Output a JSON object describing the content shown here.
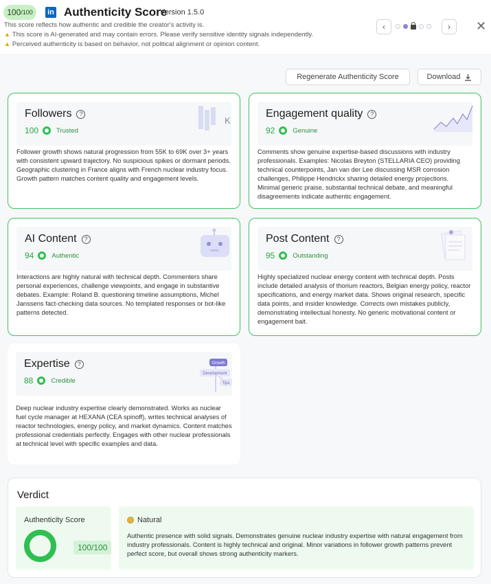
{
  "header": {
    "score_big": "100",
    "score_small": "/100",
    "title": "Authenticity Score",
    "version": "Version 1.5.0",
    "note1": "This score reflects how authentic and credible the creator's activity is.",
    "note2": "This score is AI-generated and may contain errors. Please verify sensitive identity signals independently.",
    "note3": "Perceived authenticity is based on behavior, not political alignment or opinion content."
  },
  "actions": {
    "regenerate": "Regenerate Authenticity Score",
    "download": "Download"
  },
  "cards": {
    "followers": {
      "title": "Followers",
      "score": "100",
      "label": "Trusted",
      "text": "Follower growth shows natural progression from 55K to 69K over 3+ years with consistent upward trajectory. No suspicious spikes or dormant periods. Geographic clustering in France aligns with French nuclear industry focus. Growth pattern matches content quality and engagement levels.",
      "icon_letter": "K"
    },
    "engagement": {
      "title": "Engagement quality",
      "score": "92",
      "label": "Genuine",
      "text": "Comments show genuine expertise-based discussions with industry professionals. Examples: Nicolas Breyton (STELLARIA CEO) providing technical counterpoints, Jan van der Lee discussing MSR corrosion challenges, Philippe Hendrickx sharing detailed energy projections. Minimal generic praise, substantial technical debate, and meaningful disagreements indicate authentic engagement."
    },
    "ai": {
      "title": "AI Content",
      "score": "94",
      "label": "Authentic",
      "text": "Interactions are highly natural with technical depth. Commenters share personal experiences, challenge viewpoints, and engage in substantive debates. Example: Roland B. questioning timeline assumptions, Michel Janssens fact-checking data sources. No templated responses or bot-like patterns detected."
    },
    "post": {
      "title": "Post Content",
      "score": "95",
      "label": "Outstanding",
      "text": "Highly specialized nuclear energy content with technical depth. Posts include detailed analysis of thorium reactors, Belgian energy policy, reactor specifications, and energy market data. Shows original research, specific data points, and insider knowledge. Corrects own mistakes publicly, demonstrating intellectual honesty. No generic motivational content or engagement bait."
    },
    "expertise": {
      "title": "Expertise",
      "score": "88",
      "label": "Credible",
      "text": "Deep nuclear industry expertise clearly demonstrated. Works as nuclear fuel cycle manager at HEXANA (CEA spinoff), writes technical analyses of reactor technologies, energy policy, and market dynamics. Content matches professional credentials perfectly. Engages with other nuclear professionals at technical level with specific examples and data.",
      "icon_tags": [
        "Growth",
        "Development",
        "Tips"
      ]
    }
  },
  "verdict": {
    "heading": "Verdict",
    "score_label": "Authenticity Score",
    "score_value": "100/100",
    "score_fraction": 1.0,
    "tag": "Natural",
    "text": "Authentic presence with solid signals. Demonstrates genuine nuclear industry expertise with natural engagement from industry professionals. Content is highly technical and original. Minor variations in follower growth patterns prevent perfect score, but overall shows strong authenticity markers."
  },
  "colors": {
    "accent_green": "#2fbf52",
    "linkedin_blue": "#0a66c2",
    "warning": "#e0a416"
  }
}
